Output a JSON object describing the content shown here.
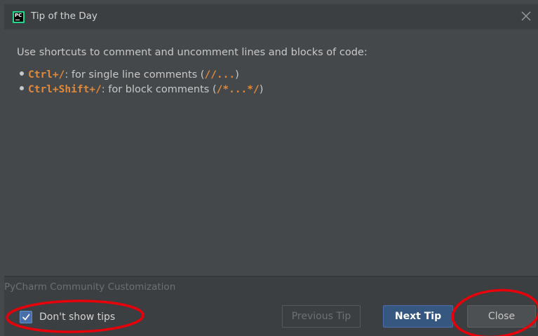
{
  "window": {
    "title": "Tip of the Day",
    "app_icon": "pycharm-icon",
    "app_icon_text": "PC",
    "close_icon": "close-icon"
  },
  "tip": {
    "headline": "Use shortcuts to comment and uncomment lines and blocks of code:",
    "items": [
      {
        "shortcut": "Ctrl+/",
        "text": ": for single line comments (",
        "code": "//...",
        "suffix": ")"
      },
      {
        "shortcut": "Ctrl+Shift+/",
        "text": ": for block comments (",
        "code": "/*...*/",
        "suffix": ")"
      }
    ]
  },
  "footer": {
    "product_name": "PyCharm Community Customization",
    "dont_show_label": "Don't show tips",
    "dont_show_checked": true,
    "previous_label": "Previous Tip",
    "next_label": "Next Tip",
    "close_label": "Close"
  },
  "annotations": {
    "circle_color": "#e8000b",
    "circled": [
      "dont-show-tips-checkbox",
      "close-button"
    ]
  },
  "colors": {
    "accent_code": "#e0893b",
    "primary_button": "#365880",
    "checkbox": "#4a6ea8"
  }
}
